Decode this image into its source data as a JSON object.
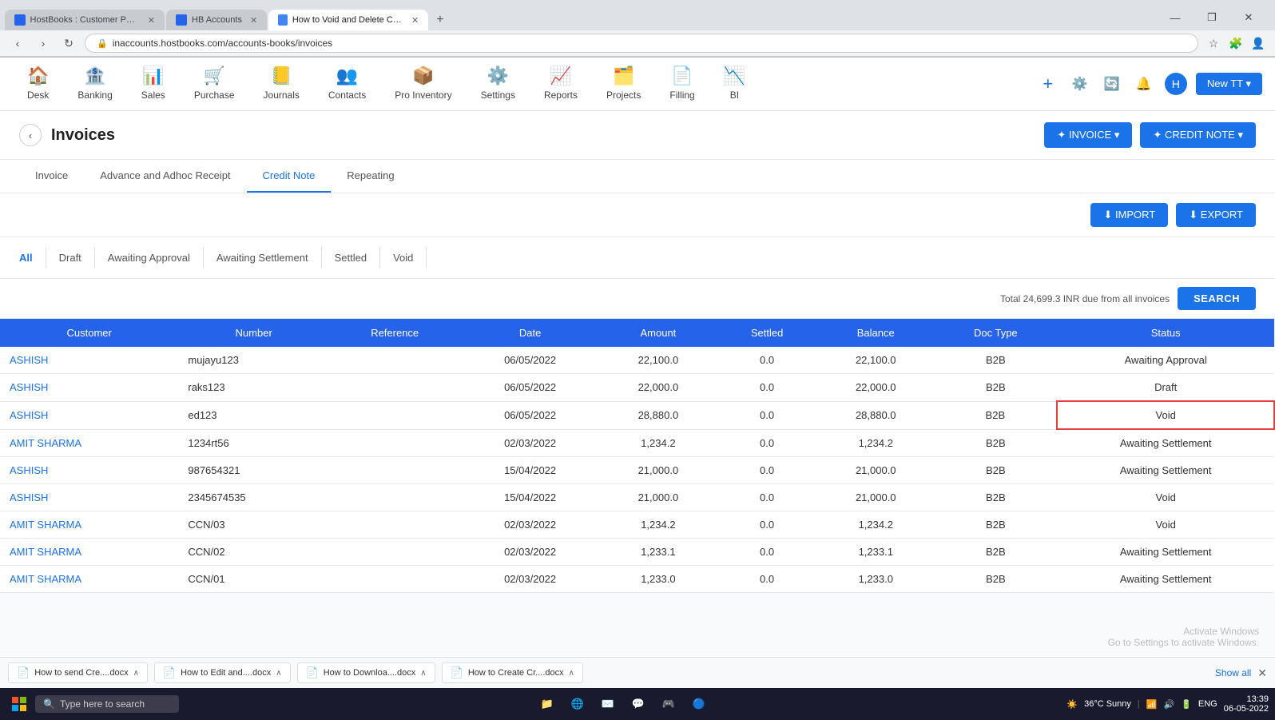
{
  "browser": {
    "tabs": [
      {
        "id": 1,
        "label": "HostBooks : Customer Portal",
        "icon": "hb",
        "active": false
      },
      {
        "id": 2,
        "label": "HB Accounts",
        "icon": "hb",
        "active": false
      },
      {
        "id": 3,
        "label": "How to Void and Delete Credit N...",
        "icon": "how",
        "active": true
      }
    ],
    "address": "inaccounts.hostbooks.com/accounts-books/invoices",
    "window_controls": [
      "—",
      "❐",
      "✕"
    ]
  },
  "nav": {
    "items": [
      {
        "id": "desk",
        "label": "Desk",
        "icon": "🏠"
      },
      {
        "id": "banking",
        "label": "Banking",
        "icon": "🏦"
      },
      {
        "id": "sales",
        "label": "Sales",
        "icon": "📊"
      },
      {
        "id": "purchase",
        "label": "Purchase",
        "icon": "🛒"
      },
      {
        "id": "journals",
        "label": "Journals",
        "icon": "📒"
      },
      {
        "id": "contacts",
        "label": "Contacts",
        "icon": "👥"
      },
      {
        "id": "pro-inventory",
        "label": "Pro Inventory",
        "icon": "📦"
      },
      {
        "id": "settings",
        "label": "Settings",
        "icon": "⚙️"
      },
      {
        "id": "reports",
        "label": "Reports",
        "icon": "📈"
      },
      {
        "id": "projects",
        "label": "Projects",
        "icon": "🗂️"
      },
      {
        "id": "filling",
        "label": "Filling",
        "icon": "📄"
      },
      {
        "id": "bi",
        "label": "BI",
        "icon": "📉"
      }
    ],
    "new_tt_label": "New TT ▾"
  },
  "page": {
    "title": "Invoices",
    "back_label": "‹",
    "buttons": {
      "invoice": "✦ INVOICE ▾",
      "credit_note": "✦ CREDIT NOTE ▾",
      "import": "⬇ IMPORT",
      "export": "⬇ EXPORT",
      "search": "SEARCH"
    },
    "tabs": [
      {
        "id": "invoice",
        "label": "Invoice",
        "active": false
      },
      {
        "id": "advance",
        "label": "Advance and Adhoc Receipt",
        "active": false
      },
      {
        "id": "credit-note",
        "label": "Credit Note",
        "active": true
      },
      {
        "id": "repeating",
        "label": "Repeating",
        "active": false
      }
    ],
    "status_filters": [
      {
        "id": "all",
        "label": "All",
        "active": true
      },
      {
        "id": "draft",
        "label": "Draft",
        "active": false
      },
      {
        "id": "awaiting-approval",
        "label": "Awaiting Approval",
        "active": false
      },
      {
        "id": "awaiting-settlement",
        "label": "Awaiting Settlement",
        "active": false
      },
      {
        "id": "settled",
        "label": "Settled",
        "active": false
      },
      {
        "id": "void",
        "label": "Void",
        "active": false
      }
    ],
    "total_info": "Total 24,699.3 INR due from all invoices",
    "table": {
      "headers": [
        "Customer",
        "Number",
        "Reference",
        "Date",
        "Amount",
        "Settled",
        "Balance",
        "Doc Type",
        "Status"
      ],
      "rows": [
        {
          "customer": "ASHISH",
          "number": "mujayu123",
          "reference": "",
          "date": "06/05/2022",
          "amount": "22,100.0",
          "settled": "0.0",
          "balance": "22,100.0",
          "doc_type": "B2B",
          "status": "Awaiting Approval",
          "void_highlight": false
        },
        {
          "customer": "ASHISH",
          "number": "raks123",
          "reference": "",
          "date": "06/05/2022",
          "amount": "22,000.0",
          "settled": "0.0",
          "balance": "22,000.0",
          "doc_type": "B2B",
          "status": "Draft",
          "void_highlight": false
        },
        {
          "customer": "ASHISH",
          "number": "ed123",
          "reference": "",
          "date": "06/05/2022",
          "amount": "28,880.0",
          "settled": "0.0",
          "balance": "28,880.0",
          "doc_type": "B2B",
          "status": "Void",
          "void_highlight": true
        },
        {
          "customer": "AMIT SHARMA",
          "number": "1234rt56",
          "reference": "",
          "date": "02/03/2022",
          "amount": "1,234.2",
          "settled": "0.0",
          "balance": "1,234.2",
          "doc_type": "B2B",
          "status": "Awaiting Settlement",
          "void_highlight": false
        },
        {
          "customer": "ASHISH",
          "number": "987654321",
          "reference": "",
          "date": "15/04/2022",
          "amount": "21,000.0",
          "settled": "0.0",
          "balance": "21,000.0",
          "doc_type": "B2B",
          "status": "Awaiting Settlement",
          "void_highlight": false
        },
        {
          "customer": "ASHISH",
          "number": "2345674535",
          "reference": "",
          "date": "15/04/2022",
          "amount": "21,000.0",
          "settled": "0.0",
          "balance": "21,000.0",
          "doc_type": "B2B",
          "status": "Void",
          "void_highlight": false
        },
        {
          "customer": "AMIT SHARMA",
          "number": "CCN/03",
          "reference": "",
          "date": "02/03/2022",
          "amount": "1,234.2",
          "settled": "0.0",
          "balance": "1,234.2",
          "doc_type": "B2B",
          "status": "Void",
          "void_highlight": false
        },
        {
          "customer": "AMIT SHARMA",
          "number": "CCN/02",
          "reference": "",
          "date": "02/03/2022",
          "amount": "1,233.1",
          "settled": "0.0",
          "balance": "1,233.1",
          "doc_type": "B2B",
          "status": "Awaiting Settlement",
          "void_highlight": false
        },
        {
          "customer": "AMIT SHARMA",
          "number": "CCN/01",
          "reference": "",
          "date": "02/03/2022",
          "amount": "1,233.0",
          "settled": "0.0",
          "balance": "1,233.0",
          "doc_type": "B2B",
          "status": "Awaiting Settlement",
          "void_highlight": false
        }
      ]
    }
  },
  "file_bar": {
    "files": [
      {
        "name": "How to send Cre....docx"
      },
      {
        "name": "How to Edit and....docx"
      },
      {
        "name": "How to Downloa....docx"
      },
      {
        "name": "How to Create Cr....docx"
      }
    ],
    "show_all": "Show all"
  },
  "taskbar": {
    "search_placeholder": "Type here to search",
    "time": "13:39",
    "date": "06-05-2022",
    "weather": "36°C Sunny",
    "language": "ENG"
  },
  "activate_windows": {
    "line1": "Activate Windows",
    "line2": "Go to Settings to activate Windows."
  }
}
